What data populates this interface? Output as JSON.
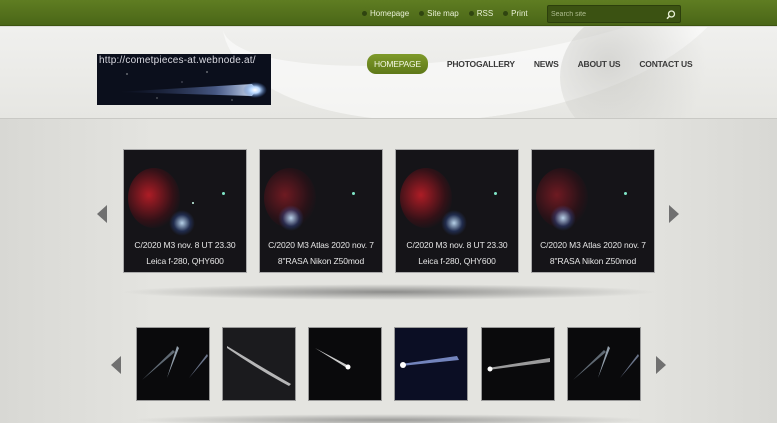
{
  "topbar": {
    "links": [
      {
        "label": "Homepage"
      },
      {
        "label": "Site map"
      },
      {
        "label": "RSS"
      },
      {
        "label": "Print"
      }
    ],
    "search_placeholder": "Search site"
  },
  "logo": {
    "url_text": "http://cometpieces-at.webnode.at/"
  },
  "nav": {
    "items": [
      {
        "label": "HOMEPAGE",
        "active": true
      },
      {
        "label": "PHOTOGALLERY"
      },
      {
        "label": "NEWS"
      },
      {
        "label": "ABOUT US"
      },
      {
        "label": "CONTACT US"
      }
    ]
  },
  "gallery": {
    "cards": [
      {
        "line1": "C/2020 M3 nov. 8 UT 23.30",
        "line2": "Leica f-280, QHY600"
      },
      {
        "line1": "C/2020 M3 Atlas 2020 nov. 7",
        "line2": "8\"RASA Nikon Z50mod"
      },
      {
        "line1": "C/2020 M3 nov. 8 UT 23.30",
        "line2": "Leica f-280, QHY600"
      },
      {
        "line1": "C/2020 M3 Atlas 2020 nov. 7",
        "line2": "8\"RASA Nikon Z50mod"
      }
    ]
  },
  "colors": {
    "accent": "#5e7818",
    "topbar": "#4f6b1a"
  }
}
